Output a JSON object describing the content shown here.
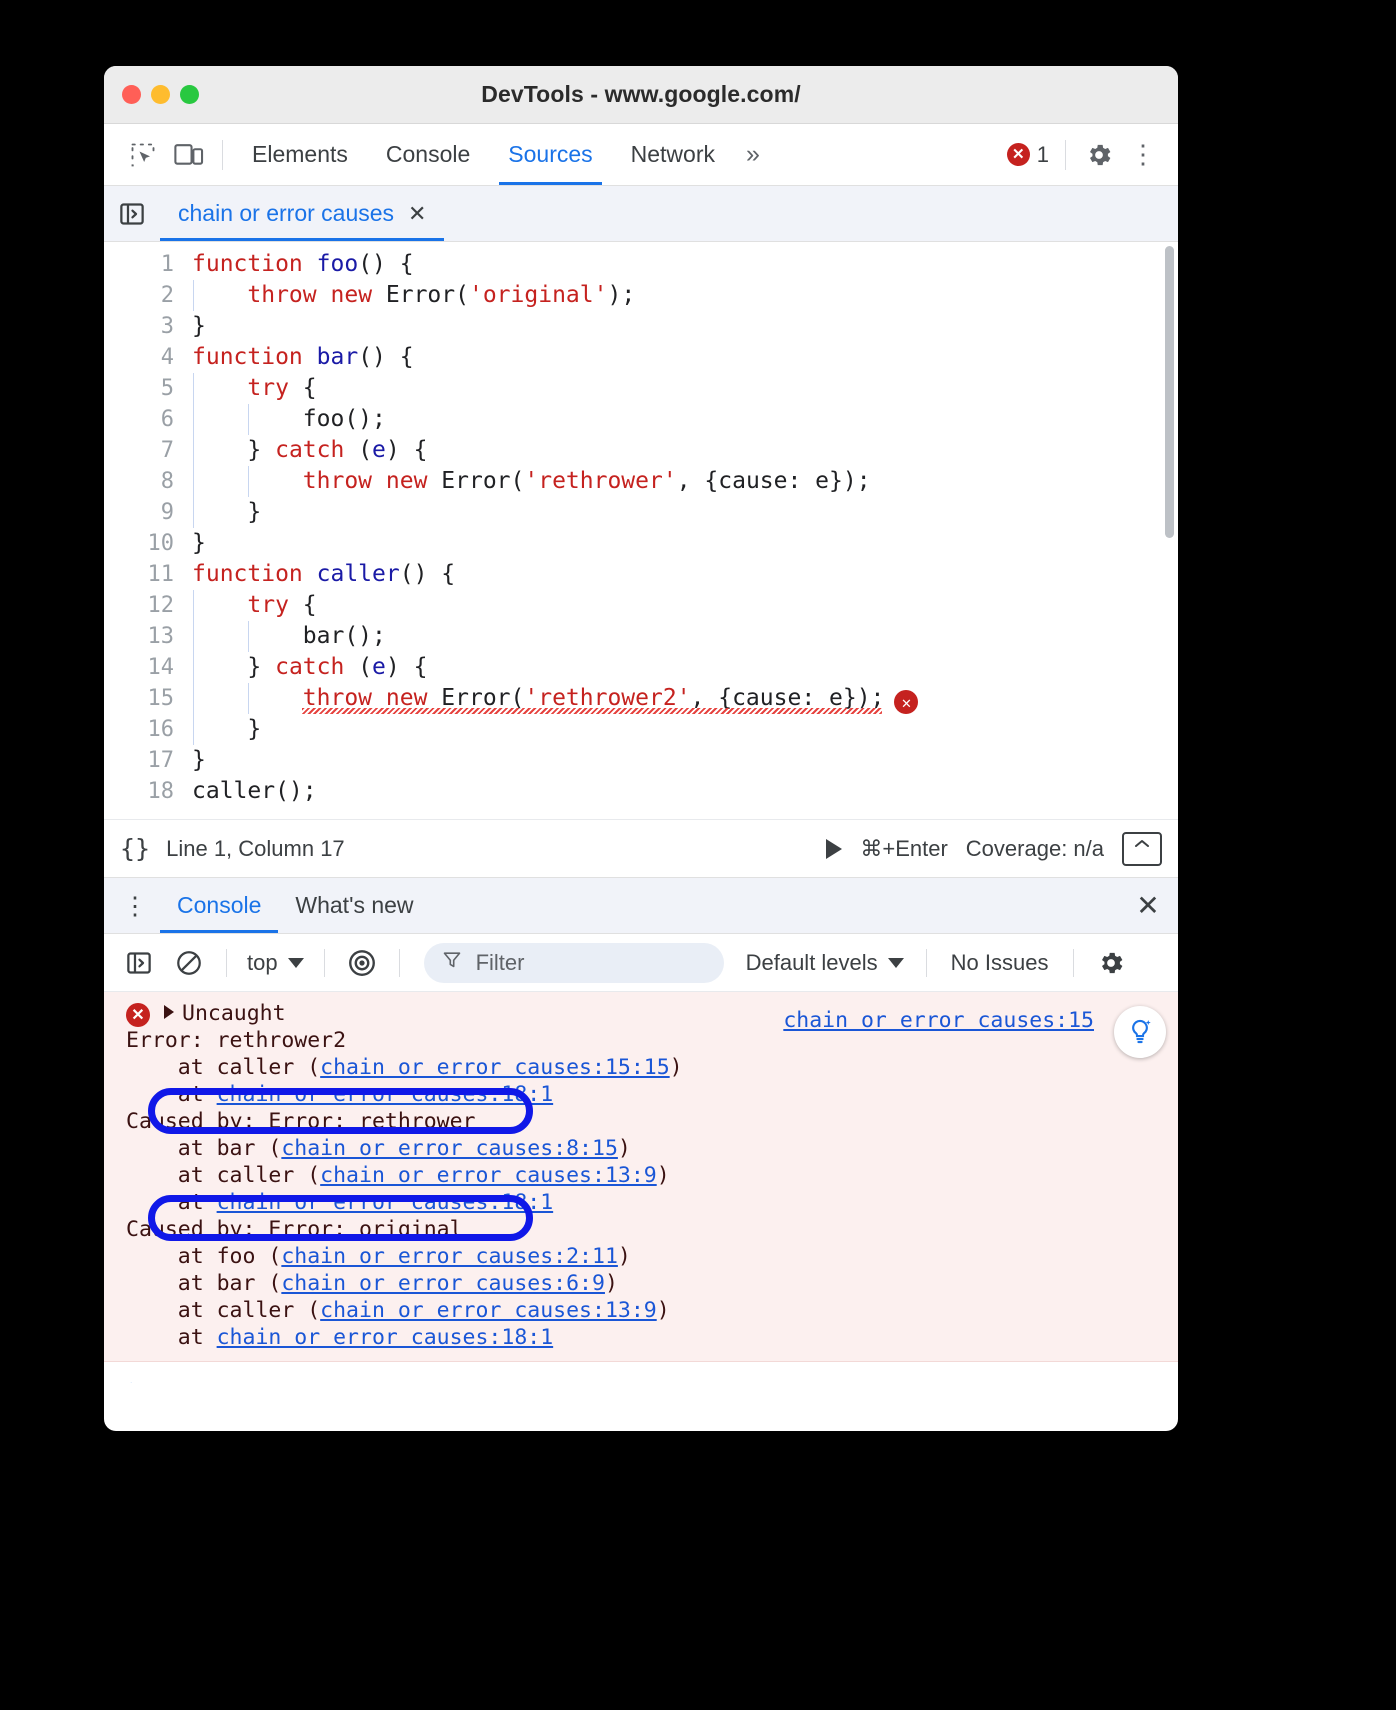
{
  "window": {
    "title": "DevTools - www.google.com/"
  },
  "main_toolbar": {
    "icons": [
      "inspect-element-icon",
      "device-toolbar-icon"
    ],
    "tabs": [
      {
        "label": "Elements",
        "active": false
      },
      {
        "label": "Console",
        "active": false
      },
      {
        "label": "Sources",
        "active": true
      },
      {
        "label": "Network",
        "active": false
      }
    ],
    "more_tabs_label": "»",
    "error_badge": {
      "icon": "error-circle-icon",
      "count": "1"
    },
    "settings_label": "gear-icon",
    "kebab_label": "⋮"
  },
  "file_strip": {
    "navigator_toggle": "show-navigator-icon",
    "tab_label": "chain or error causes",
    "close_label": "✕"
  },
  "editor": {
    "scrollbar": true,
    "lines": [
      {
        "n": "1",
        "tokens": [
          {
            "t": "function",
            "c": "kw"
          },
          {
            "t": " ",
            "c": "plain"
          },
          {
            "t": "foo",
            "c": "fn"
          },
          {
            "t": "() {",
            "c": "plain"
          }
        ]
      },
      {
        "n": "2",
        "tokens": [
          {
            "t": "    ",
            "c": "plain"
          },
          {
            "t": "throw",
            "c": "kw"
          },
          {
            "t": " ",
            "c": "plain"
          },
          {
            "t": "new",
            "c": "kw"
          },
          {
            "t": " Error(",
            "c": "plain"
          },
          {
            "t": "'original'",
            "c": "str"
          },
          {
            "t": ");",
            "c": "plain"
          }
        ]
      },
      {
        "n": "3",
        "tokens": [
          {
            "t": "}",
            "c": "plain"
          }
        ]
      },
      {
        "n": "4",
        "tokens": [
          {
            "t": "function",
            "c": "kw"
          },
          {
            "t": " ",
            "c": "plain"
          },
          {
            "t": "bar",
            "c": "fn"
          },
          {
            "t": "() {",
            "c": "plain"
          }
        ]
      },
      {
        "n": "5",
        "tokens": [
          {
            "t": "    ",
            "c": "plain"
          },
          {
            "t": "try",
            "c": "kw"
          },
          {
            "t": " {",
            "c": "plain"
          }
        ]
      },
      {
        "n": "6",
        "tokens": [
          {
            "t": "        foo();",
            "c": "plain"
          }
        ]
      },
      {
        "n": "7",
        "tokens": [
          {
            "t": "    } ",
            "c": "plain"
          },
          {
            "t": "catch",
            "c": "kw"
          },
          {
            "t": " (",
            "c": "plain"
          },
          {
            "t": "e",
            "c": "varb"
          },
          {
            "t": ") {",
            "c": "plain"
          }
        ]
      },
      {
        "n": "8",
        "tokens": [
          {
            "t": "        ",
            "c": "plain"
          },
          {
            "t": "throw",
            "c": "kw"
          },
          {
            "t": " ",
            "c": "plain"
          },
          {
            "t": "new",
            "c": "kw"
          },
          {
            "t": " Error(",
            "c": "plain"
          },
          {
            "t": "'rethrower'",
            "c": "str"
          },
          {
            "t": ", {cause: e});",
            "c": "plain"
          }
        ]
      },
      {
        "n": "9",
        "tokens": [
          {
            "t": "    }",
            "c": "plain"
          }
        ]
      },
      {
        "n": "10",
        "tokens": [
          {
            "t": "}",
            "c": "plain"
          }
        ]
      },
      {
        "n": "11",
        "tokens": [
          {
            "t": "function",
            "c": "kw"
          },
          {
            "t": " ",
            "c": "plain"
          },
          {
            "t": "caller",
            "c": "fn"
          },
          {
            "t": "() {",
            "c": "plain"
          }
        ]
      },
      {
        "n": "12",
        "tokens": [
          {
            "t": "    ",
            "c": "plain"
          },
          {
            "t": "try",
            "c": "kw"
          },
          {
            "t": " {",
            "c": "plain"
          }
        ]
      },
      {
        "n": "13",
        "tokens": [
          {
            "t": "        bar();",
            "c": "plain"
          }
        ]
      },
      {
        "n": "14",
        "tokens": [
          {
            "t": "    } ",
            "c": "plain"
          },
          {
            "t": "catch",
            "c": "kw"
          },
          {
            "t": " (",
            "c": "plain"
          },
          {
            "t": "e",
            "c": "varb"
          },
          {
            "t": ") {",
            "c": "plain"
          }
        ]
      },
      {
        "n": "15",
        "tokens": [
          {
            "t": "        ",
            "c": "plain"
          },
          {
            "t": "throw",
            "c": "kw"
          },
          {
            "t": " ",
            "c": "plain"
          },
          {
            "t": "new",
            "c": "kw"
          },
          {
            "t": " Error(",
            "c": "plain"
          },
          {
            "t": "'rethrower2'",
            "c": "str"
          },
          {
            "t": ", {cause: e});",
            "c": "plain"
          }
        ],
        "error": true
      },
      {
        "n": "16",
        "tokens": [
          {
            "t": "    }",
            "c": "plain"
          }
        ]
      },
      {
        "n": "17",
        "tokens": [
          {
            "t": "}",
            "c": "plain"
          }
        ]
      },
      {
        "n": "18",
        "tokens": [
          {
            "t": "caller();",
            "c": "plain"
          }
        ]
      }
    ]
  },
  "status_bar": {
    "format_icon": "{}",
    "position": "Line 1, Column 17",
    "run_icon": "play-icon",
    "run_shortcut": "⌘+Enter",
    "coverage": "Coverage: n/a",
    "popout_icon": "popout-icon"
  },
  "drawer": {
    "kebab": "⋮",
    "tabs": [
      {
        "label": "Console",
        "active": true
      },
      {
        "label": "What's new",
        "active": false
      }
    ],
    "close": "✕"
  },
  "console_toolbar": {
    "sidebar_icon": "console-sidebar-icon",
    "clear_icon": "clear-console-icon",
    "context": "top",
    "eye_icon": "live-expression-icon",
    "filter_icon": "filter-icon",
    "filter_placeholder": "Filter",
    "levels": "Default levels",
    "issues": "No Issues",
    "settings_icon": "gear-icon"
  },
  "console_output": {
    "error": {
      "icon": "error-circle-icon",
      "label": "Uncaught",
      "source_link": "chain or error causes:15",
      "ai_icon": "ai-assistance-icon",
      "lines": [
        {
          "kind": "title",
          "text": "Error: rethrower2"
        },
        {
          "kind": "frame",
          "prefix": "    at caller (",
          "link": "chain or error causes:15:15",
          "suffix": ")"
        },
        {
          "kind": "frame",
          "prefix": "    at ",
          "link": "chain or error causes:18:1",
          "suffix": ""
        },
        {
          "kind": "cause",
          "text": "Caused by: Error: rethrower"
        },
        {
          "kind": "frame",
          "prefix": "    at bar (",
          "link": "chain or error causes:8:15",
          "suffix": ")"
        },
        {
          "kind": "frame",
          "prefix": "    at caller (",
          "link": "chain or error causes:13:9",
          "suffix": ")"
        },
        {
          "kind": "frame",
          "prefix": "    at ",
          "link": "chain or error causes:18:1",
          "suffix": ""
        },
        {
          "kind": "cause",
          "text": "Caused by: Error: original"
        },
        {
          "kind": "frame",
          "prefix": "    at foo (",
          "link": "chain or error causes:2:11",
          "suffix": ")"
        },
        {
          "kind": "frame",
          "prefix": "    at bar (",
          "link": "chain or error causes:6:9",
          "suffix": ")"
        },
        {
          "kind": "frame",
          "prefix": "    at caller (",
          "link": "chain or error causes:13:9",
          "suffix": ")"
        },
        {
          "kind": "frame",
          "prefix": "    at ",
          "link": "chain or error causes:18:1",
          "suffix": ""
        }
      ]
    },
    "prompt_chevron": "›"
  },
  "annotations": {
    "color": "#1018e8",
    "highlights": [
      "Caused by: Error: rethrower",
      "Caused by: Error: original"
    ]
  }
}
